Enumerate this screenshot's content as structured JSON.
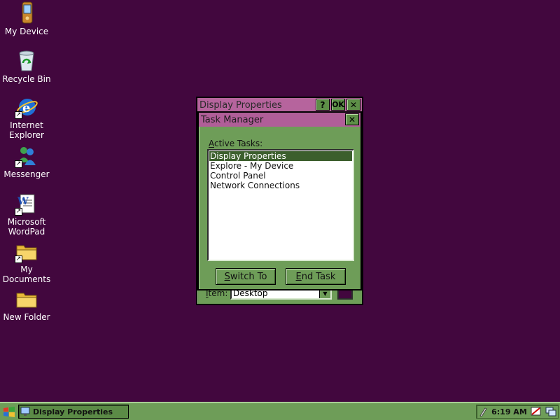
{
  "desktop": {
    "background": "#42073e",
    "icons": [
      {
        "label": "My Device",
        "icon": "pda-device-icon"
      },
      {
        "label": "Recycle Bin",
        "icon": "recycle-bin-icon"
      },
      {
        "label": "Internet Explorer",
        "icon": "internet-explorer-icon"
      },
      {
        "label": "Messenger",
        "icon": "messenger-icon"
      },
      {
        "label": "Microsoft WordPad",
        "icon": "wordpad-icon"
      },
      {
        "label": "My Documents",
        "icon": "folder-icon"
      },
      {
        "label": "New Folder",
        "icon": "folder-icon"
      }
    ]
  },
  "display_properties": {
    "title": "Display Properties",
    "help_button": "?",
    "ok_button": "OK",
    "close_button": "✕",
    "item_label_prefix": "I",
    "item_label_rest": "tem:",
    "item_value": "Desktop"
  },
  "task_manager": {
    "title": "Task Manager",
    "close_button": "✕",
    "active_tasks_prefix": "A",
    "active_tasks_rest": "ctive Tasks:",
    "tasks": [
      "Display Properties",
      "Explore - My Device",
      "Control Panel",
      "Network Connections"
    ],
    "selected_index": 0,
    "switch_to_prefix": "S",
    "switch_to_rest": "witch To",
    "end_task_prefix": "E",
    "end_task_rest": "nd Task"
  },
  "taskbar": {
    "task_button_label": "Display Properties",
    "clock": "6:19 AM"
  },
  "colors": {
    "window_face": "#6e9d58",
    "title_active": "#b05e98",
    "selection": "#3c5f2d"
  }
}
